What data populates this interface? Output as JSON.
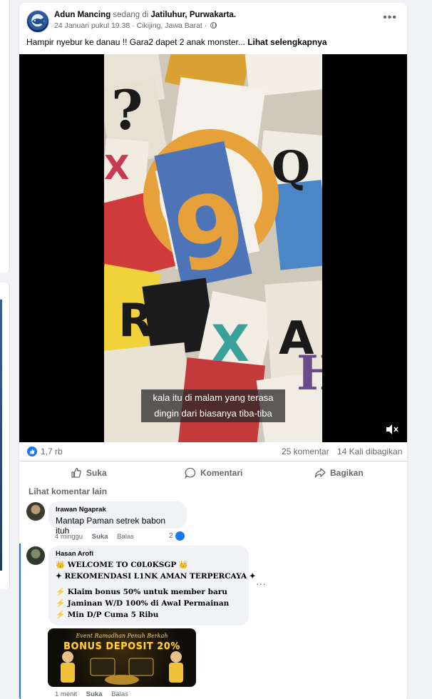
{
  "post": {
    "author": "Adun Mancing",
    "action_text": "sedang di",
    "location": "Jatiluhur, Purwakarta.",
    "date": "24 Januari pukul 19.38",
    "place": "Cikijing, Jawa Barat",
    "caption": "Hampir nyebur ke danau !! Gara2 dapet 2 anak monster...",
    "see_more": "Lihat selengkapnya"
  },
  "video": {
    "subtitle_line1": "kala itu di malam yang terasa",
    "subtitle_line2": "dingin dari biasanya tiba-tiba",
    "tiles": [
      "?",
      "Q",
      "X",
      "9",
      "R",
      "A",
      "X",
      "H"
    ]
  },
  "stats": {
    "likes": "1,7 rb",
    "comments": "25 komentar",
    "shares": "14 Kali dibagikan"
  },
  "actions": {
    "like": "Suka",
    "comment": "Komentari",
    "share": "Bagikan"
  },
  "comments_section": {
    "see_more": "Lihat komentar lain"
  },
  "comments": [
    {
      "name": "Irawan Ngaprak",
      "text": "Mantap Paman setrek babon ituh",
      "time": "4 minggu",
      "like": "Suka",
      "reply": "Balas",
      "reactions": "2"
    },
    {
      "name": "Hasan Arofi",
      "lines": [
        "👑 WELCOME TO C0L0KSGP 👑",
        "✦ REKOMENDASI L1NK AMAN TERPERCAYA ✦",
        "⚡ Klaim bonus 50% untuk member baru",
        "⚡ Jaminan W/D 100% di Awal Permainan",
        "⚡ Min D/P Cuma 5 Ribu"
      ],
      "time": "1 menit",
      "like": "Suka",
      "reply": "Balas",
      "banner_title": "Event Ramadhan Penuh Berkah",
      "banner_bonus": "BONUS DEPOSIT 20%"
    }
  ],
  "colors": {
    "accent": "#1877f2",
    "text_secondary": "#65676b",
    "bubble": "#f0f2f5"
  }
}
